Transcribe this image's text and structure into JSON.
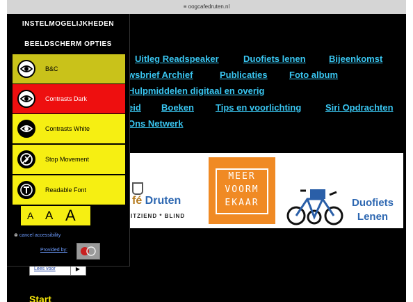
{
  "browser": {
    "url": "≡ oogcafedruten.nl"
  },
  "nav": {
    "links": [
      {
        "label": "Uitleg Readspeaker"
      },
      {
        "label": "Duofiets lenen"
      },
      {
        "label": "Bijeenkomst"
      },
      {
        "label": "wsbrief Archief"
      },
      {
        "label": "Publicaties"
      },
      {
        "label": "Foto album"
      },
      {
        "label": "Hulpmiddelen digitaal en overig"
      },
      {
        "label": "eid"
      },
      {
        "label": "Boeken"
      },
      {
        "label": "Tips en voorlichting"
      },
      {
        "label": "Siri Opdrachten"
      },
      {
        "label": "Ons Netwerk"
      }
    ],
    "link_color": "#39c5f0"
  },
  "banner": {
    "cafe_name_fe": "fé",
    "cafe_name_rest": " Druten",
    "cafe_sub": "ITZIEND * BLIND",
    "meer_lines": [
      "MEER",
      "VOORM",
      "EKAAR"
    ],
    "duofiets_line1": "Duofiets",
    "duofiets_line2": "Lenen"
  },
  "reader": {
    "label": "Lees voor",
    "play_icon": "▶"
  },
  "page": {
    "start_heading": "Start",
    "heading_color": "#f6e70a"
  },
  "a11y_panel": {
    "title": "INSTELMOGELIJKHEDEN",
    "subtitle": "BEELDSCHERM OPTIES",
    "options": [
      {
        "label": "B&C",
        "icon": "eye-icon",
        "bg": "#c9c21a"
      },
      {
        "label": "Contrasts Dark",
        "icon": "eye-icon",
        "bg": "#ee0f0f"
      },
      {
        "label": "Contrasts White",
        "icon": "eye-icon",
        "bg": "#f6ef12"
      },
      {
        "label": "Stop Movement",
        "icon": "stop-movement-icon",
        "bg": "#f6ef12"
      },
      {
        "label": "Readable Font",
        "icon": "font-t-icon",
        "bg": "#f6ef12"
      }
    ],
    "font_sizes": [
      "A",
      "A",
      "A"
    ],
    "cancel_label": "cancel accessibility",
    "provided_label": "Provided by:"
  }
}
